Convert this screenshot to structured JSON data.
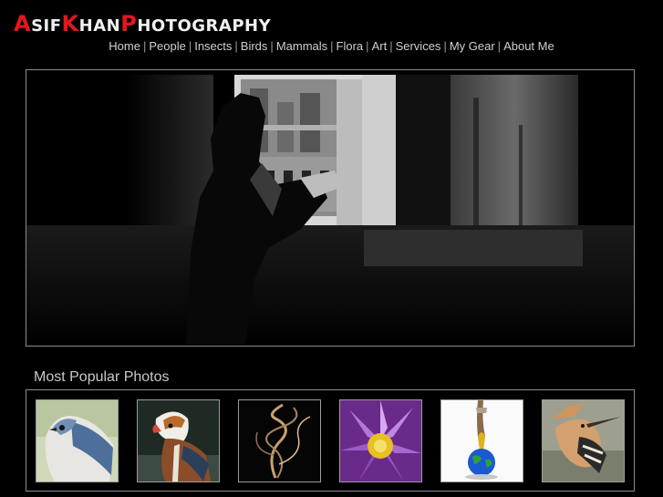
{
  "site": {
    "logo_parts": [
      {
        "text": "A",
        "cap": true
      },
      {
        "text": "SIF",
        "cap": false
      },
      {
        "text": "K",
        "cap": true
      },
      {
        "text": "HAN",
        "cap": false
      },
      {
        "text": "P",
        "cap": true
      },
      {
        "text": "HOTOGRAPHY",
        "cap": false
      }
    ],
    "accent_color": "#e4161e"
  },
  "nav": {
    "items": [
      {
        "label": "Home"
      },
      {
        "label": "People"
      },
      {
        "label": "Insects"
      },
      {
        "label": "Birds"
      },
      {
        "label": "Mammals"
      },
      {
        "label": "Flora"
      },
      {
        "label": "Art"
      },
      {
        "label": "Services"
      },
      {
        "label": "My Gear"
      },
      {
        "label": "About Me"
      }
    ],
    "separator": "|"
  },
  "hero": {
    "subject": "silhouette-reader-temple-photo"
  },
  "popular": {
    "title": "Most Popular Photos",
    "thumbnails": [
      {
        "name": "blue-bird-photo"
      },
      {
        "name": "mandarin-duck-photo"
      },
      {
        "name": "smoke-art-photo"
      },
      {
        "name": "purple-lotus-photo"
      },
      {
        "name": "globe-splash-photo"
      },
      {
        "name": "hoopoe-bird-photo"
      }
    ]
  }
}
